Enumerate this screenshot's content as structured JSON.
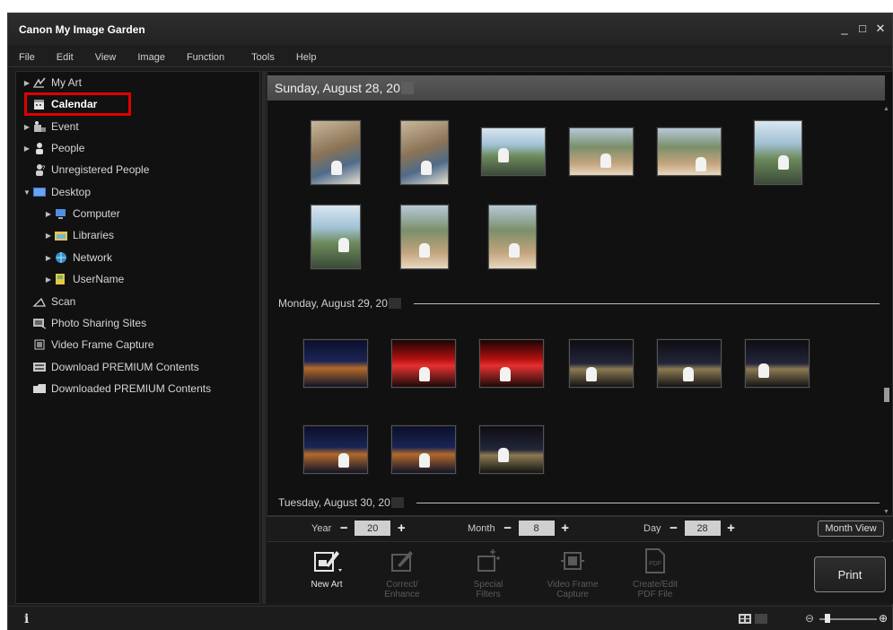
{
  "app": {
    "title": "Canon My Image Garden"
  },
  "window_controls": {
    "minimize": "_",
    "maximize": "□",
    "close": "✕"
  },
  "menu": [
    "File",
    "Edit",
    "View",
    "Image",
    "Function",
    "Tools",
    "Help"
  ],
  "sidebar": {
    "items": [
      {
        "label": "My Art",
        "icon": "my-art-icon",
        "expandable": true
      },
      {
        "label": "Calendar",
        "icon": "calendar-icon",
        "expandable": false,
        "selected": true
      },
      {
        "label": "Event",
        "icon": "event-icon",
        "expandable": true
      },
      {
        "label": "People",
        "icon": "people-icon",
        "expandable": true
      },
      {
        "label": "Unregistered People",
        "icon": "unregistered-people-icon",
        "expandable": false
      },
      {
        "label": "Desktop",
        "icon": "desktop-icon",
        "expandable": true,
        "expanded": true
      },
      {
        "label": "Computer",
        "icon": "computer-icon",
        "expandable": true
      },
      {
        "label": "Libraries",
        "icon": "libraries-icon",
        "expandable": true
      },
      {
        "label": "Network",
        "icon": "network-icon",
        "expandable": true
      },
      {
        "label": "UserName",
        "icon": "user-folder-icon",
        "expandable": true
      },
      {
        "label": "Scan",
        "icon": "scan-icon",
        "expandable": false
      },
      {
        "label": "Photo Sharing Sites",
        "icon": "photo-sharing-icon",
        "expandable": false
      },
      {
        "label": "Video Frame Capture",
        "icon": "video-frame-icon",
        "expandable": false
      },
      {
        "label": "Download PREMIUM Contents",
        "icon": "download-premium-icon",
        "expandable": false
      },
      {
        "label": "Downloaded PREMIUM Contents",
        "icon": "downloaded-premium-icon",
        "expandable": false
      }
    ]
  },
  "main": {
    "header_date": "Sunday, August 28, 20",
    "day_separators": [
      "Monday, August 29, 20",
      "Tuesday, August 30, 20"
    ]
  },
  "datebar": {
    "year_label": "Year",
    "year_value": "20",
    "month_label": "Month",
    "month_value": "8",
    "day_label": "Day",
    "day_value": "28",
    "minus": "−",
    "plus": "+",
    "month_view_label": "Month View"
  },
  "toolbar": {
    "tools": [
      {
        "label": "New Art",
        "enabled": true
      },
      {
        "label": "Correct/\nEnhance",
        "enabled": false
      },
      {
        "label": "Special\nFilters",
        "enabled": false
      },
      {
        "label": "Video Frame\nCapture",
        "enabled": false
      },
      {
        "label": "Create/Edit\nPDF File",
        "enabled": false
      }
    ],
    "print_label": "Print"
  },
  "statusbar": {
    "info": "i",
    "zoom_minus": "⊖",
    "zoom_plus": "⊕"
  },
  "colors": {
    "selection_border": "#e00000",
    "background": "#1c1c1c"
  }
}
